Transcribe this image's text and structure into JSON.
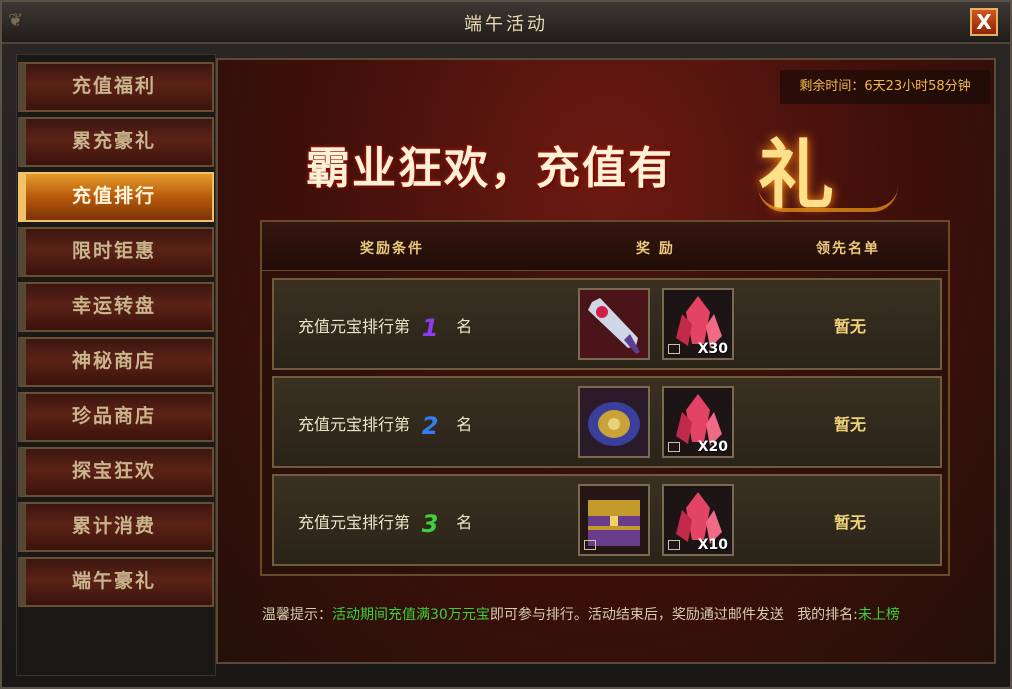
{
  "window": {
    "title": "端午活动",
    "close_label": "X"
  },
  "sidebar": {
    "items": [
      {
        "label": "充值福利"
      },
      {
        "label": "累充豪礼"
      },
      {
        "label": "充值排行"
      },
      {
        "label": "限时钜惠"
      },
      {
        "label": "幸运转盘"
      },
      {
        "label": "神秘商店"
      },
      {
        "label": "珍品商店"
      },
      {
        "label": "探宝狂欢"
      },
      {
        "label": "累计消费"
      },
      {
        "label": "端午豪礼"
      }
    ],
    "active_index": 2
  },
  "main": {
    "timer": "剩余时间：6天23小时58分钟",
    "banner": {
      "text": "霸业狂欢，充值有",
      "highlight": "礼"
    },
    "table": {
      "headers": [
        "奖励条件",
        "奖 励",
        "领先名单"
      ],
      "rows": [
        {
          "condition": "充值元宝排行第",
          "rank": "1",
          "suffix": "名",
          "rank_color": "#8a3cf0",
          "rewards": [
            {
              "icon": "sword-icon",
              "qty": ""
            },
            {
              "icon": "red-crystal-icon",
              "qty": "X30"
            }
          ],
          "leader": "暂无"
        },
        {
          "condition": "充值元宝排行第",
          "rank": "2",
          "suffix": "名",
          "rank_color": "#2f7ff2",
          "rewards": [
            {
              "icon": "armor-icon",
              "qty": ""
            },
            {
              "icon": "red-crystal-icon",
              "qty": "X20"
            }
          ],
          "leader": "暂无"
        },
        {
          "condition": "充值元宝排行第",
          "rank": "3",
          "suffix": "名",
          "rank_color": "#3fcf3f",
          "rewards": [
            {
              "icon": "treasure-chest-icon",
              "qty": ""
            },
            {
              "icon": "red-crystal-icon",
              "qty": "X10"
            }
          ],
          "leader": "暂无"
        }
      ]
    },
    "footer": {
      "prefix": "温馨提示：",
      "highlight": "活动期间充值满30万元宝",
      "middle": "即可参与排行。活动结束后，奖励通过邮件发送",
      "rank_label": "我的排名:",
      "rank_value": "未上榜"
    }
  }
}
